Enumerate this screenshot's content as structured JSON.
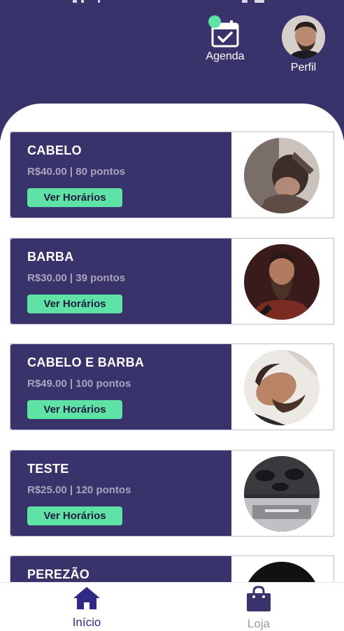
{
  "header": {
    "agenda_label": "Agenda",
    "perfil_label": "Perfil"
  },
  "services": [
    {
      "name": "CABELO",
      "price": "R$40.00 | 80 pontos",
      "button": "Ver Horários"
    },
    {
      "name": "BARBA",
      "price": "R$30.00 | 39 pontos",
      "button": "Ver Horários"
    },
    {
      "name": "CABELO E BARBA",
      "price": "R$49.00 | 100 pontos",
      "button": "Ver Horários"
    },
    {
      "name": "TESTE",
      "price": "R$25.00 | 120 pontos",
      "button": "Ver Horários"
    },
    {
      "name": "PEREZÃO",
      "price": "",
      "button": ""
    }
  ],
  "nav": {
    "inicio_label": "Início",
    "loja_label": "Loja"
  },
  "colors": {
    "brand": "#38336a",
    "accent": "#5ee2a6",
    "active_nav": "#2e2a86",
    "inactive_nav": "#9a98aa"
  },
  "icons": {
    "agenda": "calendar-check-icon",
    "inicio": "home-icon",
    "loja": "shopping-bag-icon"
  }
}
